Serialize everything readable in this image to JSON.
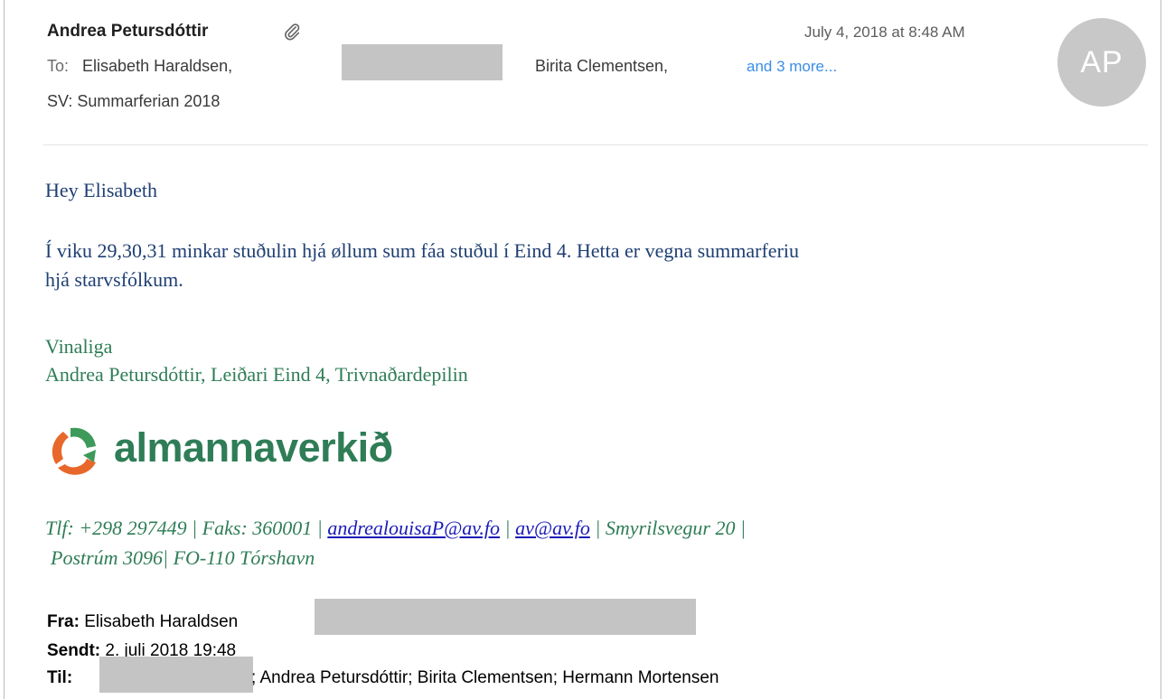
{
  "header": {
    "sender": "Andrea Petursdóttir",
    "date": "July 4, 2018 at 8:48 AM",
    "avatar_initials": "AP",
    "to_label": "To:",
    "to_first": "Elisabeth Haraldsen,",
    "to_second": "Birita Clementsen,",
    "more_link": "and 3 more...",
    "subject": "SV: Summarferian 2018"
  },
  "body": {
    "greeting": "Hey Elisabeth",
    "line1": "Í viku 29,30,31 minkar stuðulin hjá øllum sum fáa stuðul í Eind 4. Hetta er vegna summarferiu",
    "line2": "hjá starvsfólkum.",
    "sig_line1": "Vinaliga",
    "sig_line2": "Andrea Petursdóttir, Leiðari Eind 4, Trivnaðardepilin"
  },
  "logo": {
    "text": "almannaverkið"
  },
  "contact": {
    "phone": "Tlf: +298 297449 |  Faks: 360001 | ",
    "email1": "andrealouisaP@av.fo",
    "sep1": " | ",
    "email2": "av@av.fo",
    "address1": " | Smyrilsvegur 20 |",
    "address2": "Postrúm 3096|  FO-110 Tórshavn"
  },
  "quoted": {
    "from_label": "Fra:",
    "from_value": "Elisabeth Haraldsen",
    "sent_label": "Sendt:",
    "sent_value": "2. juli 2018 19:48",
    "to_label": "Til:",
    "to_value": "; Andrea Petursdóttir; Birita Clementsen; Hermann Mortensen"
  },
  "colors": {
    "body_text": "#1f3f73",
    "signature": "#2f7d57",
    "link": "#3a8ee6",
    "logo_orange": "#e8672a",
    "logo_green": "#3d9a5a"
  },
  "icons": {
    "attachment": "paperclip-icon",
    "logo_mark": "almannaverkid-logo-icon"
  }
}
